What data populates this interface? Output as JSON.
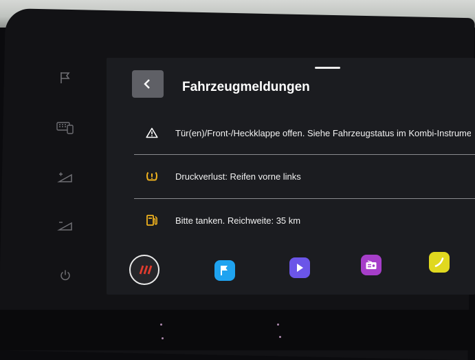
{
  "header": {
    "title": "Fahrzeugmeldungen"
  },
  "messages": [
    {
      "icon": "warning-triangle-icon",
      "text": "Tür(en)/Front-/Heckklappe offen. Siehe Fahrzeugstatus im Kombi-Instrume"
    },
    {
      "icon": "tire-pressure-icon",
      "text": "Druckverlust: Reifen vorne links"
    },
    {
      "icon": "fuel-pump-icon",
      "text": "Bitte tanken. Reichweite: 35 km"
    }
  ],
  "dock": {
    "apps": [
      "home-menu-icon",
      "navigation-flag-icon",
      "media-play-icon",
      "radio-icon",
      "phone-icon"
    ]
  },
  "colors": {
    "warning_icon": "#f0b21e",
    "home_stripes": "#e23b2e",
    "nav_app": "#1fa3f0",
    "media_app": "#6b55e8",
    "radio_app": "#a63ec9",
    "phone_app": "#e0d81f"
  }
}
